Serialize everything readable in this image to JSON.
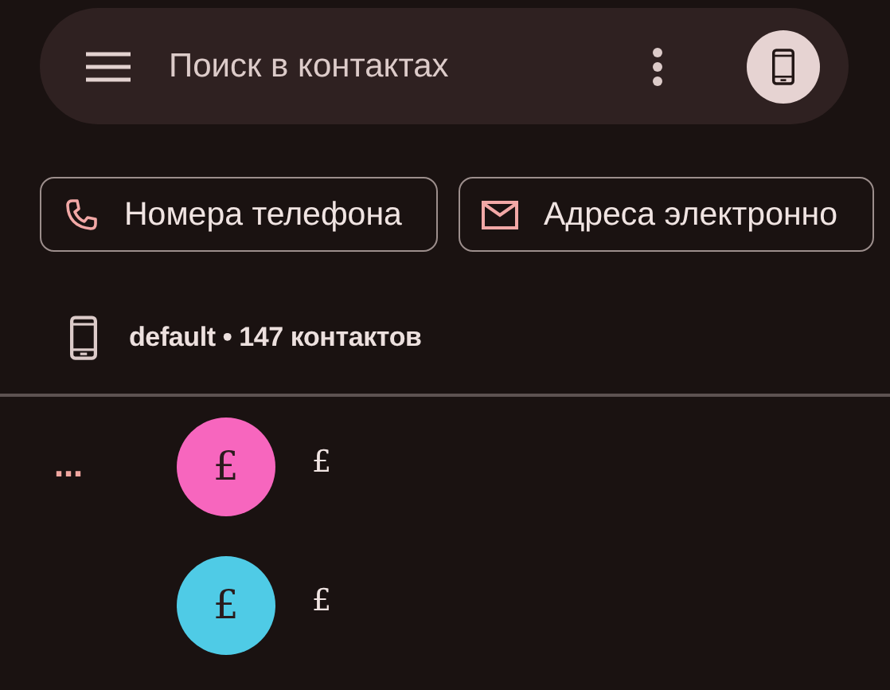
{
  "search": {
    "placeholder": "Поиск в контактах"
  },
  "filters": [
    {
      "label": "Номера телефона",
      "kind": "phone"
    },
    {
      "label": "Адреса электронно",
      "kind": "email"
    }
  ],
  "account": {
    "label": "default • 147 контактов"
  },
  "groups": [
    {
      "label": "…",
      "contacts": [
        {
          "initial": "£",
          "name": "£",
          "color": "#f766be"
        },
        {
          "initial": "£",
          "name": "£",
          "color": "#4fcbe6"
        }
      ]
    }
  ]
}
